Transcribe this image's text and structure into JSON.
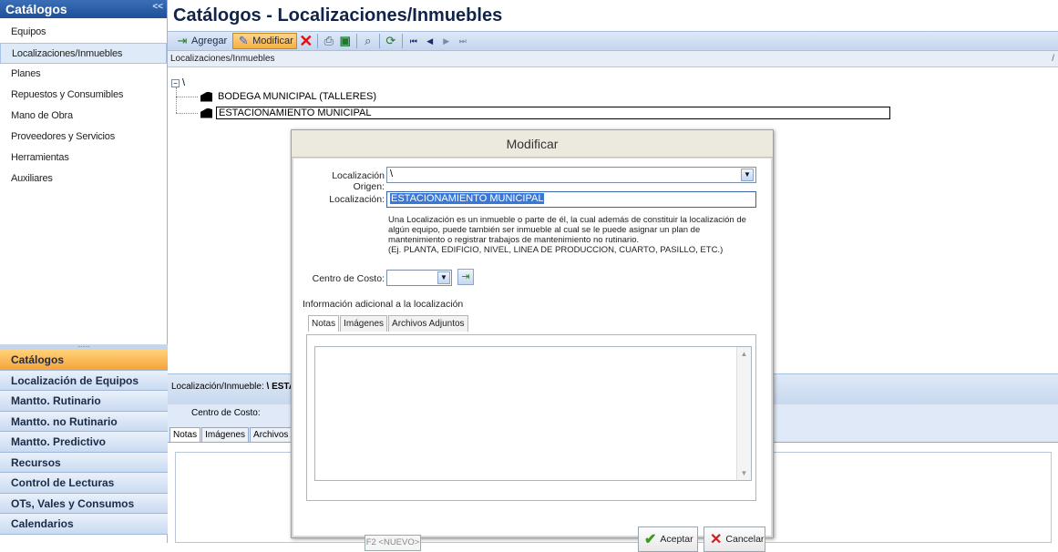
{
  "sidebar": {
    "header": "Catálogos",
    "collapse": "<<",
    "items": [
      {
        "label": "Equipos"
      },
      {
        "label": "Localizaciones/Inmuebles"
      },
      {
        "label": "Planes"
      },
      {
        "label": "Repuestos y Consumibles"
      },
      {
        "label": "Mano de Obra"
      },
      {
        "label": "Proveedores y Servicios"
      },
      {
        "label": "Herramientas"
      },
      {
        "label": "Auxiliares"
      }
    ],
    "grip": "........",
    "nav": [
      {
        "label": "Catálogos"
      },
      {
        "label": "Localización de Equipos"
      },
      {
        "label": "Mantto. Rutinario"
      },
      {
        "label": "Mantto. no Rutinario"
      },
      {
        "label": "Mantto. Predictivo"
      },
      {
        "label": "Recursos"
      },
      {
        "label": "Control de Lecturas"
      },
      {
        "label": "OTs, Vales y Consumos"
      },
      {
        "label": "Calendarios"
      }
    ]
  },
  "main": {
    "title": "Catálogos - Localizaciones/Inmuebles",
    "toolbar": {
      "agregar": "Agregar",
      "modificar": "Modificar",
      "icons": [
        "add-icon",
        "edit-icon",
        "delete-icon",
        "print-icon",
        "excel-icon",
        "search-icon",
        "refresh-icon",
        "first-icon",
        "prev-icon",
        "next-icon",
        "last-icon"
      ]
    },
    "tree_header": "Localizaciones/Inmuebles",
    "tree_header_right": "/",
    "tree": {
      "root": "\\",
      "nodes": [
        "BODEGA MUNICIPAL (TALLERES)",
        "ESTACIONAMIENTO MUNICIPAL"
      ]
    },
    "detail": {
      "loc_label": "Localización/Inmueble:",
      "loc_value": "\\ ESTAC",
      "cc_label": "Centro de Costo:",
      "tabs": [
        "Notas",
        "Imágenes",
        "Archivos A"
      ]
    }
  },
  "modal": {
    "title": "Modificar",
    "origen_label": "Localización Origen:",
    "origen_value": "\\",
    "loc_label": "Localización:",
    "loc_value": "ESTACIONAMIENTO MUNICIPAL",
    "description": "Una Localización es un inmueble o parte de él, la cual además de constituir la localización de algún equipo, puede también ser inmueble al cual se le puede asignar un plan de mantenimiento o registrar trabajos de mantenimiento no rutinario.",
    "example": "(Ej. PLANTA, EDIFICIO, NIVEL, LINEA DE PRODUCCION, CUARTO, PASILLO, ETC.)",
    "cc_label": "Centro de Costo:",
    "cc_value": "",
    "info_label": "Información adicional a la localización",
    "tabs": [
      "Notas",
      "Imágenes",
      "Archivos Adjuntos"
    ],
    "f2": "F2 <NUEVO>",
    "accept": "Aceptar",
    "cancel": "Cancelar"
  },
  "colors": {
    "accent": "#1f4f97",
    "highlight": "#f5b043",
    "selection": "#3a78d8"
  }
}
